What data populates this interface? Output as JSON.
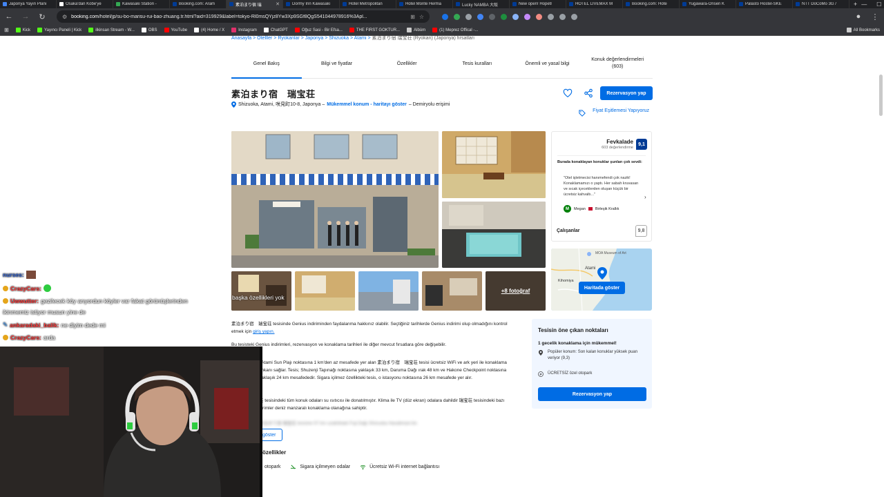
{
  "browser": {
    "tabs": [
      {
        "title": "Japonya Yayın Plani",
        "color": "#4285f4"
      },
      {
        "title": "Osaka'dan Kobe'ye",
        "color": "#ffffff"
      },
      {
        "title": "Kawasaki Station -",
        "color": "#34a853"
      },
      {
        "title": "Booking.com: Aram",
        "color": "#003b95"
      },
      {
        "title": "素泊まり宿 瑞",
        "color": "#003b95",
        "active": true
      },
      {
        "title": "Dormy Inn Kawasaki",
        "color": "#003b95"
      },
      {
        "title": "Hotel Metropolitan",
        "color": "#003b95"
      },
      {
        "title": "Hotel Monte Herma",
        "color": "#003b95"
      },
      {
        "title": "Lucky NAMBA 大阪",
        "color": "#003b95"
      },
      {
        "title": "New open! Hopetr",
        "color": "#003b95"
      },
      {
        "title": "HOTEL LIVEMAX M",
        "color": "#003b95"
      },
      {
        "title": "Booking.com: Hote",
        "color": "#003b95"
      },
      {
        "title": "Yugawara-Onsen K",
        "color": "#003b95"
      },
      {
        "title": "Palasto Hostel-SKE",
        "color": "#003b95"
      },
      {
        "title": "NTT DoCoMo 3G /",
        "color": "#003b95"
      }
    ],
    "new_tab": "+",
    "url_domain": "booking.com",
    "url_rest": "/hotel/jp/su-bo-marisu-rui-bao-zhuang.tr.html?aid=319929&label=tokyo-Rl0msQYjz8Yw3Xp9SGf8QgS541044978916%3Apl...",
    "bookmarks": [
      {
        "label": "Kick",
        "color": "#53fc18"
      },
      {
        "label": "Yayıncı Paneli | Kick",
        "color": "#53fc18"
      },
      {
        "label": "ilkinsan Stream - W...",
        "color": "#53fc18"
      },
      {
        "label": "OBS",
        "color": "#ffffff"
      },
      {
        "label": "YouTube",
        "color": "#ff0000"
      },
      {
        "label": "(4) Home / X",
        "color": "#ffffff"
      },
      {
        "label": "Instagram",
        "color": "#e1306c"
      },
      {
        "label": "ChatGPT",
        "color": "#ffffff"
      },
      {
        "label": "Oğuz Sasi - Bir Efsa...",
        "color": "#ff0000"
      },
      {
        "label": "THE FIRST GOKTUR...",
        "color": "#ff0000"
      },
      {
        "label": "Albüm",
        "color": "#cccccc"
      },
      {
        "label": "(1) Meprez Offical -...",
        "color": "#ff0000"
      }
    ],
    "all_bookmarks": "All Bookmarks"
  },
  "breadcrumb": {
    "items": "Anasayfa  >  Otelller  >  Ryokanlar  >  Japonya  >  Shizuoka  >  Atami  >",
    "current": "素泊まり宿 瑞宝荘 (Ryokan) (Japonya) fırsatları"
  },
  "page_tabs": [
    {
      "label": "Genel Bakış",
      "active": true
    },
    {
      "label": "Bilgi ve fiyatlar"
    },
    {
      "label": "Özellikler"
    },
    {
      "label": "Tesis kuralları"
    },
    {
      "label": "Önemli ve yasal bilgi"
    },
    {
      "label": "Konuk değerlendirmeleri",
      "sub": "(603)"
    }
  ],
  "hotel": {
    "name": "素泊まり宿　瑞宝荘",
    "address": "Shizuoka, Atami, 咲見町10-8, Japonya –",
    "location_link": "Mükemmel konum - haritayı göster",
    "rail": "– Demiryolu erişimi",
    "reserve_btn": "Rezervasyon yap",
    "price_match": "Fiyat Eşitlemesi Yapıyoruz",
    "more_photos": "+8 fotoğraf"
  },
  "review": {
    "word": "Fevkalade",
    "count": "603 değerlendirme",
    "score": "9,1",
    "heading": "Burada konaklayan konuklar şunları çok sevdi:",
    "quote": "\"Otel işletmecisi hanımefendi çok nazik! Konaklamamızı o yaptı. Her sabah kruvasan ve sıcak içeceklerden oluşan küçük bir ücretsiz kahvaltı...\"",
    "user": "Megan",
    "user_initial": "M",
    "country": "Birleşik Krallık",
    "staff_label": "Çalışanlar",
    "staff_score": "9,8",
    "map_btn": "Haritada göster",
    "map_place": "Atami",
    "map_place2": "Kihomiya",
    "map_museum": "MOA Museum of Art"
  },
  "description": {
    "p1": "素泊まり宿　瑞宝荘 tesisinde Genius indiriminden faydalanma hakkınız olabilir. Seçtiğiniz tarihlerde Genius indirimi olup olmadığını kontrol etmek için",
    "p1_link": "giriş yapın.",
    "p2": "Bu tesisteki Genius indirimleri, rezervasyon ve konaklama tarihleri ile diğer mevcut fırsatlara göre değişebilir.",
    "p3": ", Atami Sun Plajı noktasına 1 km'den az mesafede yer alan 素泊まり宿　瑞宝荘 tesisi ücretsiz WiFi ve ark yeri ile konaklama imkanı sağlar. Tesis; Shuzenji Tapınağı noktasına yaklaşık 33 km, Daruma Dağı ırak 48 km ve Hakone Checkpoint noktasına yaklaşık 24 km mesafededir. Sigara içilmez özellikteki tesis, o istasyonu noktasına 26 km mesafede yer alır.",
    "p4": "荘 tesisindeki tüm konuk odaları su ısıtıcısı ile donatılmıştır. Klima ile TV (düz ekran) odalara dahildir 瑞宝荘 tesisindeki bazı birimler deniz manzaralı konaklama olanağına sahiptir.",
    "p5": "素泊まり宿 瑞宝荘 tesisine 57 km uzaklıktaki Fuji Dağı Shizuoka Havalimanı'dır.",
    "show_btn": "göster"
  },
  "highlights": {
    "title": "Tesisin öne çıkan noktaları",
    "sub": "1 gecelik konaklama için mükemmel!",
    "row1": "Popüler konum: Son kalan konuklar yüksek puan veriyor (9,3)",
    "row2": "ÜCRETSİZ özel otopark",
    "btn": "Rezervasyon yap"
  },
  "facilities": {
    "title": "özellikler",
    "items": [
      "otopark",
      "Sigara içilmeyen odalar",
      "Ücretsiz Wi-Fi internet bağlantısı"
    ]
  },
  "chat": [
    {
      "user": "nurses:",
      "color": "#3a6ad6",
      "msg": ""
    },
    {
      "user": "CrazyCars:",
      "color": "#ff3b3b",
      "msg": ""
    },
    {
      "user": "Uwwutter:",
      "color": "#ff3b3b",
      "msg": "gezilecek köy arıyordun köyler var fakat görünüşlerinden"
    },
    {
      "user": "",
      "color": "#ffffff",
      "msg": "ikinmemiz istiyor musun yine de"
    },
    {
      "user": "ankaradaki_balik:",
      "color": "#ff3b3b",
      "msg": "ne diyim dede mi"
    },
    {
      "user": "CrazyCars:",
      "color": "#ff3b3b",
      "msg": "arda"
    }
  ],
  "photo_overlay_text": "başka özellikleri yok"
}
